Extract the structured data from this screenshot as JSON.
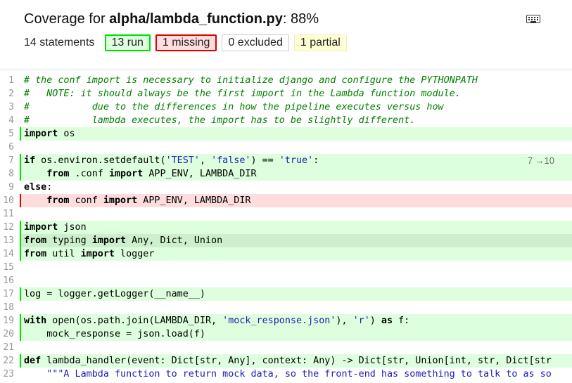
{
  "header": {
    "title_prefix": "Coverage for ",
    "title_file": "alpha/lambda_function.py",
    "title_suffix": ": 88%",
    "statements_label": "14 statements",
    "buttons": {
      "run": "13 run",
      "missing": "1 missing",
      "excluded": "0 excluded",
      "partial": "1 partial"
    }
  },
  "source": {
    "lines": [
      {
        "n": "1",
        "s": "",
        "tokens": [
          {
            "c": "com",
            "t": "# the conf import is necessary to initialize django and configure the PYTHONPATH"
          }
        ]
      },
      {
        "n": "2",
        "s": "",
        "tokens": [
          {
            "c": "com",
            "t": "#   NOTE: it should always be the first import in the Lambda function module."
          }
        ]
      },
      {
        "n": "3",
        "s": "",
        "tokens": [
          {
            "c": "com",
            "t": "#           due to the differences in how the pipeline executes versus how"
          }
        ]
      },
      {
        "n": "4",
        "s": "",
        "tokens": [
          {
            "c": "com",
            "t": "#           lambda executes, the import has to be slightly different."
          }
        ]
      },
      {
        "n": "5",
        "s": "run",
        "tokens": [
          {
            "c": "kw",
            "t": "import"
          },
          {
            "c": "",
            "t": " os"
          }
        ]
      },
      {
        "n": "6",
        "s": "",
        "tokens": []
      },
      {
        "n": "7",
        "s": "par",
        "ann": "7 →10",
        "tokens": [
          {
            "c": "kw",
            "t": "if"
          },
          {
            "c": "",
            "t": " os.environ.setdefault("
          },
          {
            "c": "str",
            "t": "'TEST'"
          },
          {
            "c": "",
            "t": ", "
          },
          {
            "c": "str",
            "t": "'false'"
          },
          {
            "c": "",
            "t": ") == "
          },
          {
            "c": "str",
            "t": "'true'"
          },
          {
            "c": "",
            "t": ":"
          }
        ]
      },
      {
        "n": "8",
        "s": "run",
        "tokens": [
          {
            "c": "",
            "t": "    "
          },
          {
            "c": "kw",
            "t": "from"
          },
          {
            "c": "",
            "t": " .conf "
          },
          {
            "c": "kw",
            "t": "import"
          },
          {
            "c": "",
            "t": " APP_ENV, LAMBDA_DIR"
          }
        ]
      },
      {
        "n": "9",
        "s": "",
        "tokens": [
          {
            "c": "kw",
            "t": "else"
          },
          {
            "c": "",
            "t": ":"
          }
        ]
      },
      {
        "n": "10",
        "s": "mis",
        "tokens": [
          {
            "c": "",
            "t": "    "
          },
          {
            "c": "kw",
            "t": "from"
          },
          {
            "c": "",
            "t": " conf "
          },
          {
            "c": "kw",
            "t": "import"
          },
          {
            "c": "",
            "t": " APP_ENV, LAMBDA_DIR"
          }
        ]
      },
      {
        "n": "11",
        "s": "",
        "tokens": []
      },
      {
        "n": "12",
        "s": "run",
        "tokens": [
          {
            "c": "kw",
            "t": "import"
          },
          {
            "c": "",
            "t": " json"
          }
        ]
      },
      {
        "n": "13",
        "s": "run hl",
        "tokens": [
          {
            "c": "kw",
            "t": "from"
          },
          {
            "c": "",
            "t": " typing "
          },
          {
            "c": "kw",
            "t": "import"
          },
          {
            "c": "",
            "t": " Any, Dict, Union"
          }
        ]
      },
      {
        "n": "14",
        "s": "run",
        "tokens": [
          {
            "c": "kw",
            "t": "from"
          },
          {
            "c": "",
            "t": " util "
          },
          {
            "c": "kw",
            "t": "import"
          },
          {
            "c": "",
            "t": " logger"
          }
        ]
      },
      {
        "n": "15",
        "s": "",
        "tokens": []
      },
      {
        "n": "16",
        "s": "",
        "tokens": []
      },
      {
        "n": "17",
        "s": "run",
        "tokens": [
          {
            "c": "",
            "t": "log = logger.getLogger(__name__)"
          }
        ]
      },
      {
        "n": "18",
        "s": "",
        "tokens": []
      },
      {
        "n": "19",
        "s": "run",
        "tokens": [
          {
            "c": "kw",
            "t": "with"
          },
          {
            "c": "",
            "t": " open(os.path.join(LAMBDA_DIR, "
          },
          {
            "c": "str",
            "t": "'mock_response.json'"
          },
          {
            "c": "",
            "t": "), "
          },
          {
            "c": "str",
            "t": "'r'"
          },
          {
            "c": "",
            "t": ") "
          },
          {
            "c": "kw",
            "t": "as"
          },
          {
            "c": "",
            "t": " f:"
          }
        ]
      },
      {
        "n": "20",
        "s": "run",
        "tokens": [
          {
            "c": "",
            "t": "    mock_response = json.load(f)"
          }
        ]
      },
      {
        "n": "21",
        "s": "",
        "tokens": []
      },
      {
        "n": "22",
        "s": "run",
        "tokens": [
          {
            "c": "kw",
            "t": "def"
          },
          {
            "c": "",
            "t": " lambda_handler(event: Dict[str, Any], context: Any) -> Dict[str, Union[int, str, Dict[str"
          }
        ]
      },
      {
        "n": "23",
        "s": "",
        "tokens": [
          {
            "c": "",
            "t": "    "
          },
          {
            "c": "doc",
            "t": "\"\"\"A Lambda function to return mock data, so the front-end has something to talk to as so"
          }
        ]
      }
    ]
  },
  "colors": {
    "run_bg": "#ddffdd",
    "run_border": "#00dd00",
    "missing_bg": "#ffdddd",
    "missing_border": "#dd0000",
    "partial_bg": "#ffffd5",
    "comment": "#008000",
    "string": "#2020b0"
  },
  "icons": {
    "keyboard": "keyboard-icon"
  }
}
